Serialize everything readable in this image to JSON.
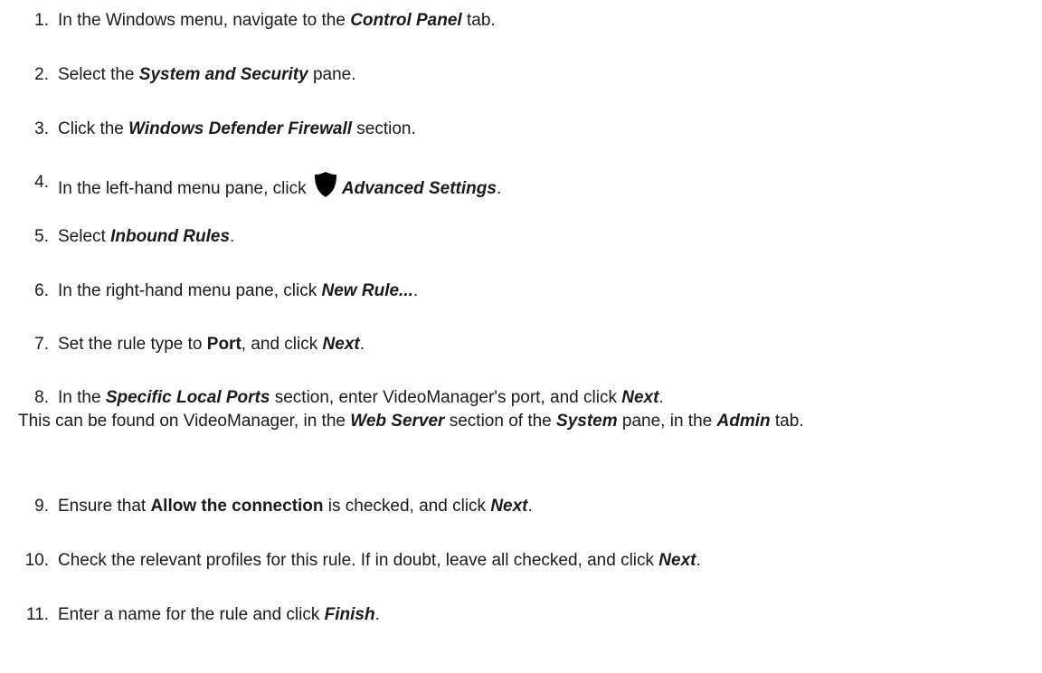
{
  "steps": [
    {
      "num": "1.",
      "parts": [
        "In the Windows menu, navigate to the ",
        "Control Panel",
        " tab."
      ]
    },
    {
      "num": "2.",
      "parts": [
        "Select the ",
        "System and Security",
        " pane."
      ]
    },
    {
      "num": "3.",
      "parts": [
        "Click the ",
        "Windows Defender Firewall",
        " section."
      ]
    },
    {
      "num": "4.",
      "parts": [
        "In the left-hand menu pane, click ",
        "Advanced Settings",
        "."
      ],
      "icon": "shield-icon"
    },
    {
      "num": "5.",
      "parts": [
        "Select ",
        "Inbound Rules",
        "."
      ]
    },
    {
      "num": "6.",
      "parts": [
        "In the right-hand menu pane, click ",
        "New Rule...",
        "."
      ]
    },
    {
      "num": "7.",
      "parts": [
        "Set the rule type to ",
        "Port",
        ", and click ",
        "Next",
        "."
      ]
    },
    {
      "num": "8.",
      "parts": [
        "In the ",
        "Specific Local Ports",
        " section, enter VideoManager's port, and click ",
        "Next",
        "."
      ]
    },
    {
      "num": "9.",
      "parts": [
        "Ensure that ",
        "Allow the connection",
        " is checked, and click ",
        "Next",
        "."
      ]
    },
    {
      "num": "10.",
      "parts": [
        "Check the relevant profiles for this rule. If in doubt, leave all checked, and click ",
        "Next",
        "."
      ]
    },
    {
      "num": "11.",
      "parts": [
        "Enter a name for the rule and click ",
        "Finish",
        "."
      ]
    }
  ],
  "note": {
    "parts": [
      "This can be found on VideoManager, in the ",
      "Web Server",
      " section of the ",
      "System",
      " pane, in the ",
      "Admin",
      " tab."
    ]
  }
}
